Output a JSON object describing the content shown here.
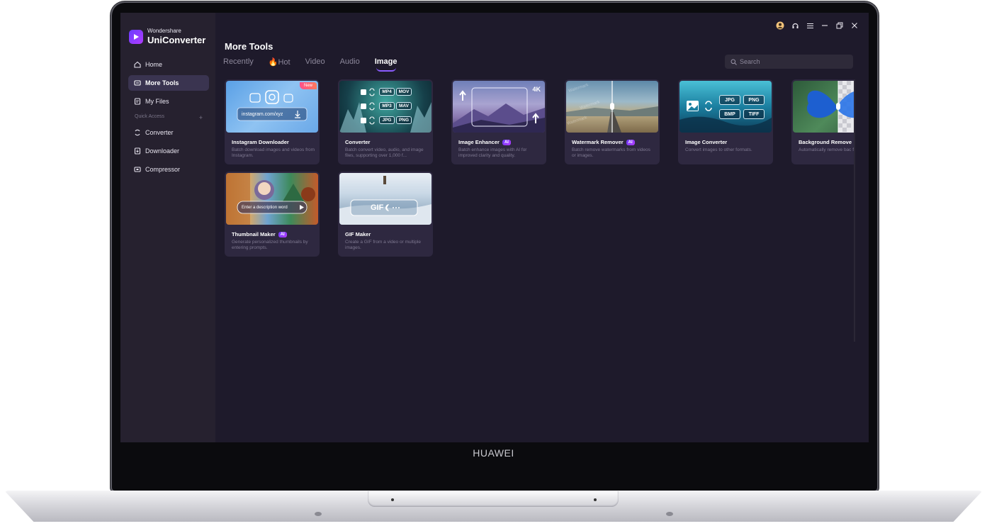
{
  "device": {
    "brand": "HUAWEI"
  },
  "app": {
    "vendor": "Wondershare",
    "name": "UniConverter"
  },
  "sidebar": {
    "items": [
      {
        "label": "Home",
        "icon": "home-icon"
      },
      {
        "label": "More Tools",
        "icon": "tools-icon",
        "active": true
      },
      {
        "label": "My Files",
        "icon": "files-icon"
      }
    ],
    "quick_access_label": "Quick Access",
    "quick_access_add": "+",
    "quick_items": [
      {
        "label": "Converter",
        "icon": "converter-icon"
      },
      {
        "label": "Downloader",
        "icon": "downloader-icon"
      },
      {
        "label": "Compressor",
        "icon": "compressor-icon"
      }
    ]
  },
  "window_controls": [
    "account-icon",
    "support-icon",
    "menu-icon",
    "minimize-icon",
    "restore-icon",
    "close-icon"
  ],
  "main": {
    "title": "More Tools",
    "tabs": [
      {
        "label": "Recently"
      },
      {
        "label": "🔥Hot"
      },
      {
        "label": "Video"
      },
      {
        "label": "Audio"
      },
      {
        "label": "Image",
        "active": true
      }
    ],
    "search": {
      "placeholder": "Search"
    },
    "cards": [
      {
        "title": "Instagram Downloader",
        "ai": false,
        "badge": "New",
        "desc": "Batch download images and videos from Instagram.",
        "thumb_text": "instagram.com/xyz"
      },
      {
        "title": "Converter",
        "ai": false,
        "desc": "Batch convert video, audio, and image files, supporting over 1,000 f...",
        "formats": [
          "MP4",
          "MOV",
          "MP3",
          "MAV",
          "JPG",
          "PNG"
        ]
      },
      {
        "title": "Image Enhancer",
        "ai": true,
        "ai_label": "AI",
        "desc": "Batch enhance images with AI for improved clarity and quality.",
        "thumb_text": "4K"
      },
      {
        "title": "Watermark Remover",
        "ai": true,
        "ai_label": "AI",
        "desc": "Batch remove watermarks from videos or images."
      },
      {
        "title": "Image Converter",
        "ai": false,
        "desc": "Convert images to other formats.",
        "formats": [
          "JPG",
          "PNG",
          "BMP",
          "TIFF"
        ]
      },
      {
        "title": "Background Remove",
        "ai": false,
        "desc": "Automatically remove bac from images."
      },
      {
        "title": "Thumbnail Maker",
        "ai": true,
        "ai_label": "AI",
        "desc": "Generate personalized thumbnails by entering prompts.",
        "thumb_text": "Enter a description word"
      },
      {
        "title": "GIF Maker",
        "ai": false,
        "desc": "Create a GIF from a video or multiple images.",
        "thumb_text": "GIF"
      }
    ]
  }
}
